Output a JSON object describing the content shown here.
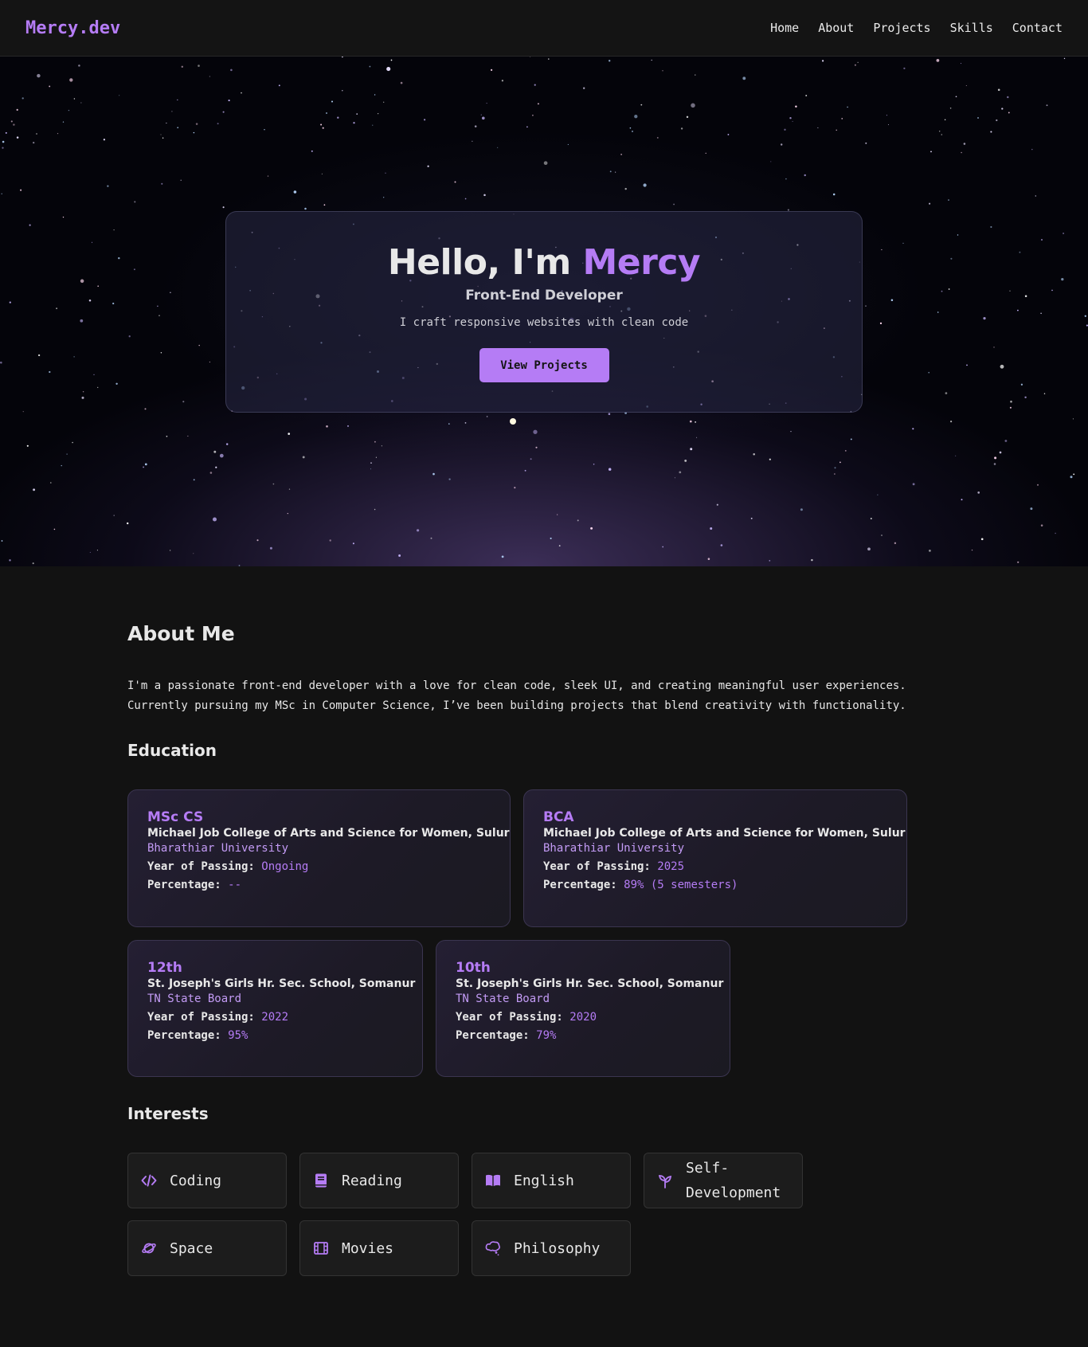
{
  "nav": {
    "brand": "Mercy.dev",
    "links": [
      "Home",
      "About",
      "Projects",
      "Skills",
      "Contact"
    ]
  },
  "hero": {
    "greeting": "Hello, I'm ",
    "name": "Mercy",
    "role": "Front-End Developer",
    "tagline": "I craft responsive websites with clean code",
    "button": "View Projects"
  },
  "about": {
    "heading": "About Me",
    "text": "I'm a passionate front-end developer with a love for clean code, sleek UI, and creating meaningful user experiences. Currently pursuing my MSc in Computer Science, I’ve been building projects that blend creativity with functionality."
  },
  "education": {
    "heading": "Education",
    "items": [
      {
        "degree": "MSc CS",
        "school": "Michael Job College of Arts and Science for Women, Sulur",
        "board": "Bharathiar University",
        "year_label": "Year of Passing:",
        "year": "Ongoing",
        "pct_label": "Percentage:",
        "pct": "--"
      },
      {
        "degree": "BCA",
        "school": "Michael Job College of Arts and Science for Women, Sulur",
        "board": "Bharathiar University",
        "year_label": "Year of Passing:",
        "year": "2025",
        "pct_label": "Percentage:",
        "pct": "89% (5 semesters)"
      },
      {
        "degree": "12th",
        "school": "St. Joseph's Girls Hr. Sec. School, Somanur",
        "board": "TN State Board",
        "year_label": "Year of Passing:",
        "year": "2022",
        "pct_label": "Percentage:",
        "pct": "95%"
      },
      {
        "degree": "10th",
        "school": "St. Joseph's Girls Hr. Sec. School, Somanur",
        "board": "TN State Board",
        "year_label": "Year of Passing:",
        "year": "2020",
        "pct_label": "Percentage:",
        "pct": "79%"
      }
    ]
  },
  "interests": {
    "heading": "Interests",
    "items": [
      {
        "label": "Coding",
        "icon": "code-icon"
      },
      {
        "label": "Reading",
        "icon": "book-icon"
      },
      {
        "label": "English",
        "icon": "open-book-icon"
      },
      {
        "label": "Self-Development",
        "icon": "seedling-icon"
      },
      {
        "label": "Space",
        "icon": "planet-icon"
      },
      {
        "label": "Movies",
        "icon": "film-icon"
      },
      {
        "label": "Philosophy",
        "icon": "thought-bubble-icon"
      }
    ]
  },
  "colors": {
    "accent": "#b57cf5",
    "background": "#121212"
  }
}
